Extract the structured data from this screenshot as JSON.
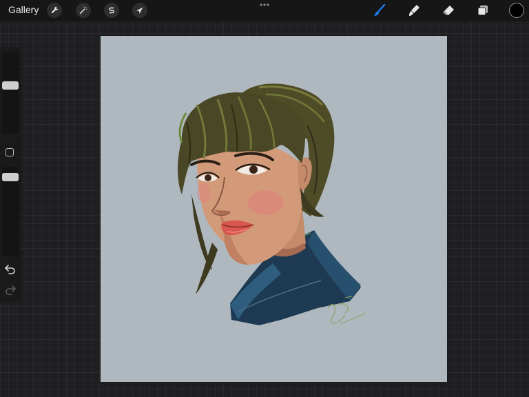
{
  "toolbar": {
    "gallery_label": "Gallery",
    "left_tools": [
      {
        "icon": "wrench-icon"
      },
      {
        "icon": "magic-wand-icon"
      },
      {
        "icon": "selection-s-icon"
      },
      {
        "icon": "move-arrow-icon"
      }
    ],
    "right_tools": [
      {
        "icon": "brush-icon",
        "active": true
      },
      {
        "icon": "smudge-icon"
      },
      {
        "icon": "eraser-icon"
      },
      {
        "icon": "layers-icon"
      }
    ],
    "current_color": "#000000",
    "active_color": "#1e7cf0"
  },
  "sidebar": {
    "brush_size_level": 0.6,
    "opacity_level": 0.15
  },
  "canvas": {
    "background": "#afb7bf"
  }
}
